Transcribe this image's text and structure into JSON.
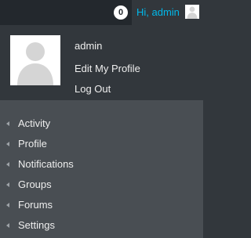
{
  "topbar": {
    "notification_count": "0",
    "greeting": "Hi, admin"
  },
  "account": {
    "display_name": "admin",
    "edit_profile_label": "Edit My Profile",
    "logout_label": "Log Out"
  },
  "menu": {
    "items": [
      {
        "label": "Activity"
      },
      {
        "label": "Profile"
      },
      {
        "label": "Notifications"
      },
      {
        "label": "Groups"
      },
      {
        "label": "Forums"
      },
      {
        "label": "Settings"
      }
    ]
  },
  "colors": {
    "topbar_bg": "#23282d",
    "panel_bg": "#32373c",
    "menu_bg": "#494e53",
    "greeting_link": "#00b9eb",
    "text": "#eeeeee",
    "arrow": "#9ea3a8"
  },
  "icons": {
    "avatar": "default-user-silhouette",
    "menu_arrow": "left-triangle"
  }
}
